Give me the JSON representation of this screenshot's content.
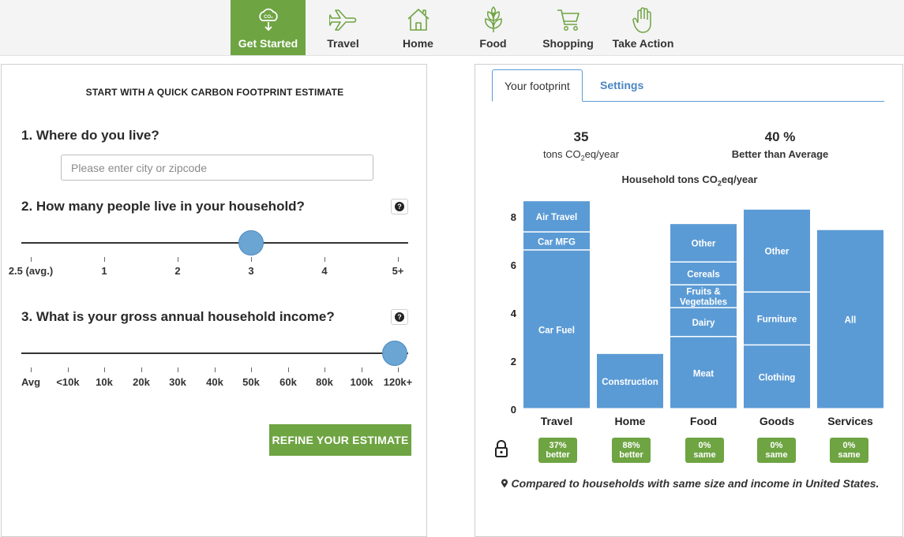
{
  "nav": {
    "items": [
      {
        "label": "Get Started",
        "icon": "co2-cloud-icon",
        "active": true
      },
      {
        "label": "Travel",
        "icon": "airplane-icon"
      },
      {
        "label": "Home",
        "icon": "house-icon"
      },
      {
        "label": "Food",
        "icon": "leaf-icon"
      },
      {
        "label": "Shopping",
        "icon": "cart-icon"
      },
      {
        "label": "Take Action",
        "icon": "hand-icon"
      }
    ],
    "active_color": "#6ea442"
  },
  "left": {
    "heading": "START WITH A QUICK CARBON FOOTPRINT ESTIMATE",
    "q1": "1. Where do you live?",
    "city_placeholder": "Please enter city or zipcode",
    "city_value": "",
    "q2": "2. How many people live in your household?",
    "household_ticks": [
      "2.5 (avg.)",
      "1",
      "2",
      "3",
      "4",
      "5+"
    ],
    "household_selected": "3",
    "q3": "3. What is your gross annual household income?",
    "income_ticks": [
      "Avg",
      "<10k",
      "10k",
      "20k",
      "30k",
      "40k",
      "50k",
      "60k",
      "80k",
      "100k",
      "120k+"
    ],
    "income_selected": "120k+",
    "refine_label": "REFINE YOUR ESTIMATE",
    "help_glyph": "?"
  },
  "right": {
    "tabs": [
      {
        "label": "Your footprint",
        "active": true
      },
      {
        "label": "Settings",
        "active": false
      }
    ],
    "total_value": "35",
    "total_label_pre": "tons CO",
    "total_label_sub": "2",
    "total_label_post": "eq/year",
    "compare_value": "40 %",
    "compare_label": "Better than Average",
    "chart_title_pre": "Household tons CO",
    "chart_title_sub": "2",
    "chart_title_post": "eq/year",
    "badges": [
      {
        "line1": "37%",
        "line2": "better"
      },
      {
        "line1": "88%",
        "line2": "better"
      },
      {
        "line1": "0%",
        "line2": "same"
      },
      {
        "line1": "0%",
        "line2": "same"
      },
      {
        "line1": "0%",
        "line2": "same"
      }
    ],
    "footnote": "Compared to households with same size and income in United States.",
    "lock_icon": "lock-icon",
    "pin_icon": "map-pin-icon"
  },
  "chart_data": {
    "type": "bar",
    "stacked": true,
    "title": "Household tons CO2eq/year",
    "ylim": [
      0,
      8.6
    ],
    "yticks": [
      0,
      2,
      4,
      6,
      8
    ],
    "bar_color": "#5b9bd5",
    "categories": [
      "Travel",
      "Home",
      "Food",
      "Goods",
      "Services"
    ],
    "stacks": [
      [
        {
          "label": "Car Fuel",
          "value": 6.6
        },
        {
          "label": "Car MFG",
          "value": 0.75
        },
        {
          "label": "Air Travel",
          "value": 1.3
        }
      ],
      [
        {
          "label": "Construction",
          "value": 2.3
        }
      ],
      [
        {
          "label": "Meat",
          "value": 3.0
        },
        {
          "label": "Dairy",
          "value": 1.2
        },
        {
          "label": "Fruits & Vegetables",
          "value": 0.95
        },
        {
          "label": "Cereals",
          "value": 0.95
        },
        {
          "label": "Other",
          "value": 1.6
        }
      ],
      [
        {
          "label": "Clothing",
          "value": 2.65
        },
        {
          "label": "Furniture",
          "value": 2.2
        },
        {
          "label": "Other",
          "value": 3.45
        }
      ],
      [
        {
          "label": "All",
          "value": 7.45
        }
      ]
    ]
  }
}
